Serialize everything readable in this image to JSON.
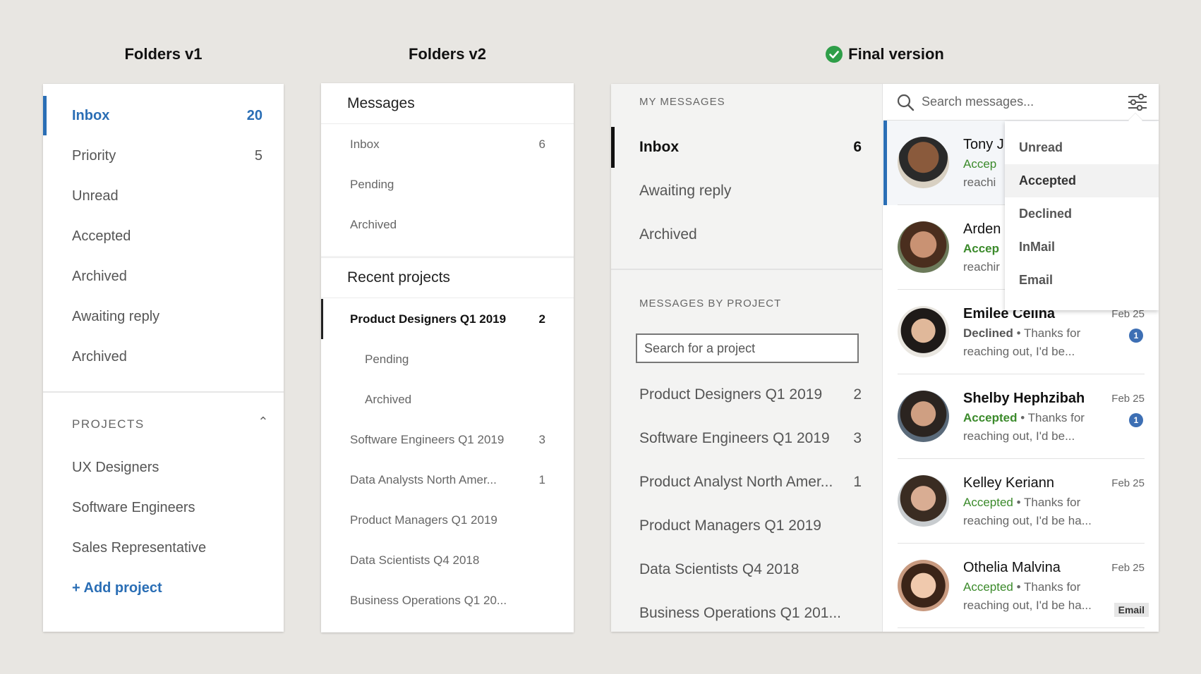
{
  "headings": {
    "v1": "Folders v1",
    "v2": "Folders v2",
    "final": "Final version",
    "final_icon": "check-circle-icon",
    "final_icon_color": "#2e9e48"
  },
  "v1": {
    "items": [
      {
        "label": "Inbox",
        "count": "20"
      },
      {
        "label": "Priority",
        "count": "5"
      },
      {
        "label": "Unread",
        "count": ""
      },
      {
        "label": "Accepted",
        "count": ""
      },
      {
        "label": "Archived",
        "count": ""
      },
      {
        "label": "Awaiting reply",
        "count": ""
      },
      {
        "label": "Archived",
        "count": ""
      }
    ],
    "projects_header": "PROJECTS",
    "projects": [
      "UX Designers",
      "Software Engineers",
      "Sales Representative"
    ],
    "add_project": "+ Add project"
  },
  "v2": {
    "messages_header": "Messages",
    "messages": [
      {
        "label": "Inbox",
        "count": "6"
      },
      {
        "label": "Pending",
        "count": ""
      },
      {
        "label": "Archived",
        "count": ""
      }
    ],
    "recent_header": "Recent projects",
    "projects": [
      {
        "label": "Product Designers Q1 2019",
        "count": "2"
      },
      {
        "label": "Pending",
        "count": ""
      },
      {
        "label": "Archived",
        "count": ""
      },
      {
        "label": "Software Engineers Q1 2019",
        "count": "3"
      },
      {
        "label": "Data Analysts North Amer...",
        "count": "1"
      },
      {
        "label": "Product Managers Q1 2019",
        "count": ""
      },
      {
        "label": "Data Scientists Q4 2018",
        "count": ""
      },
      {
        "label": "Business Operations Q1 20...",
        "count": ""
      }
    ]
  },
  "final": {
    "my_messages_caption": "MY MESSAGES",
    "folders": [
      {
        "label": "Inbox",
        "count": "6"
      },
      {
        "label": "Awaiting reply",
        "count": ""
      },
      {
        "label": "Archived",
        "count": ""
      }
    ],
    "by_project_caption": "MESSAGES BY PROJECT",
    "project_search_placeholder": "Search for a project",
    "projects": [
      {
        "label": "Product Designers Q1 2019",
        "count": "2"
      },
      {
        "label": "Software Engineers Q1 2019",
        "count": "3"
      },
      {
        "label": "Product Analyst North Amer...",
        "count": "1"
      },
      {
        "label": "Product Managers Q1 2019",
        "count": ""
      },
      {
        "label": "Data Scientists Q4 2018",
        "count": ""
      },
      {
        "label": "Business Operations Q1 201...",
        "count": ""
      }
    ],
    "search_placeholder": "Search messages...",
    "messages": [
      {
        "name": "Tony J",
        "status": "Accep",
        "snippet": "",
        "line3": "reachi",
        "date": "",
        "badge": "",
        "tag": "",
        "status_color": "#3b8a2b"
      },
      {
        "name": "Arden",
        "status": "Accep",
        "snippet": "",
        "line3": "reachir",
        "date": "",
        "badge": "",
        "tag": "",
        "status_color": "#3b8a2b"
      },
      {
        "name": "Emilee Celina",
        "status": "Declined",
        "snippet": " • Thanks for",
        "line3": "reaching out, I'd be...",
        "date": "Feb 25",
        "badge": "1",
        "tag": ""
      },
      {
        "name": "Shelby Hephzibah",
        "status": "Accepted",
        "snippet": " • Thanks for",
        "line3": "reaching out, I'd be...",
        "date": "Feb 25",
        "badge": "1",
        "tag": ""
      },
      {
        "name": "Kelley Keriann",
        "status": "Accepted",
        "snippet": " • Thanks for",
        "line3": "reaching out, I'd be ha...",
        "date": "Feb 25",
        "badge": "",
        "tag": ""
      },
      {
        "name": "Othelia Malvina",
        "status": "Accepted",
        "snippet": " • Thanks for",
        "line3": "reaching out, I'd be ha...",
        "date": "Feb 25",
        "badge": "",
        "tag": "Email"
      }
    ],
    "filter_options": [
      "Unread",
      "Accepted",
      "Declined",
      "InMail",
      "Email"
    ],
    "filter_highlighted": "Accepted",
    "accent_color": "#2a6eb5"
  }
}
